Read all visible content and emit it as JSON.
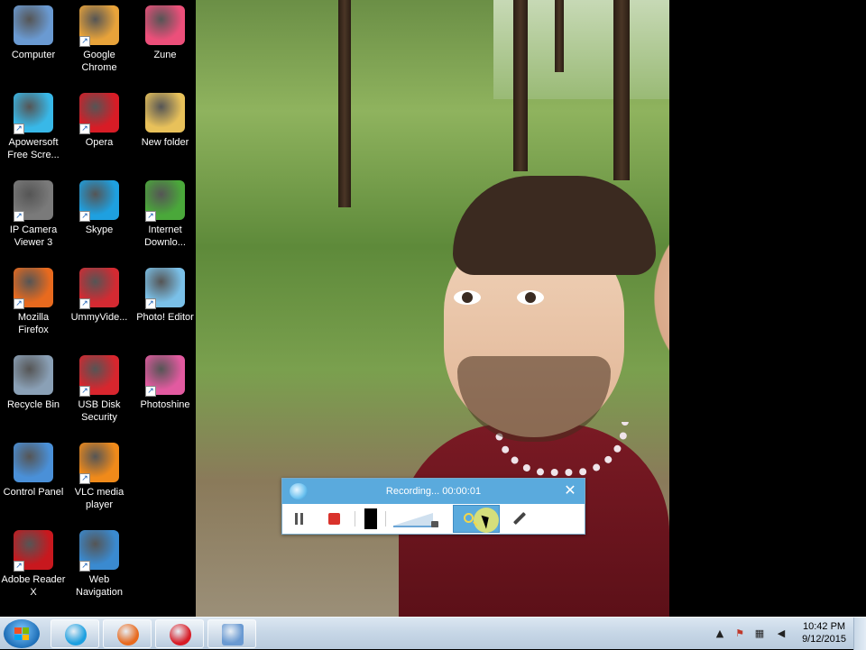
{
  "desktop": {
    "icons": [
      {
        "label": "Computer",
        "icon": "computer-icon",
        "color": "#6a9ad2"
      },
      {
        "label": "Google\nChrome",
        "icon": "chrome-icon",
        "color": "#e8a33a"
      },
      {
        "label": "Zune",
        "icon": "zune-icon",
        "color": "#ec4f7a"
      },
      {
        "label": "Apowersoft\nFree Scre...",
        "icon": "apowersoft-icon",
        "color": "#38b8e8"
      },
      {
        "label": "Opera",
        "icon": "opera-icon",
        "color": "#d81c26"
      },
      {
        "label": "New folder",
        "icon": "folder-icon",
        "color": "#e8c15a"
      },
      {
        "label": "IP Camera\nViewer 3",
        "icon": "ip-camera-icon",
        "color": "#7a7a7a"
      },
      {
        "label": "Skype",
        "icon": "skype-icon",
        "color": "#1ea0e0"
      },
      {
        "label": "Internet\nDownlo...",
        "icon": "idm-icon",
        "color": "#4aa83a"
      },
      {
        "label": "Mozilla\nFirefox",
        "icon": "firefox-icon",
        "color": "#e86a1e"
      },
      {
        "label": "UmmyVide...",
        "icon": "ummy-icon",
        "color": "#d42a32"
      },
      {
        "label": "Photo! Editor",
        "icon": "photo-editor-icon",
        "color": "#7ac0e8"
      },
      {
        "label": "Recycle Bin",
        "icon": "recycle-bin-icon",
        "color": "#8aa0b6"
      },
      {
        "label": "USB Disk\nSecurity",
        "icon": "usb-disk-security-icon",
        "color": "#d8262e"
      },
      {
        "label": "Photoshine",
        "icon": "photoshine-icon",
        "color": "#e25aa0"
      },
      {
        "label": "Control Panel",
        "icon": "control-panel-icon",
        "color": "#4a90d8"
      },
      {
        "label": "VLC media\nplayer",
        "icon": "vlc-icon",
        "color": "#f08a1a"
      },
      {
        "label": "",
        "icon": "empty",
        "color": "#000000"
      },
      {
        "label": "Adobe Reader\nX",
        "icon": "adobe-reader-icon",
        "color": "#c8181e"
      },
      {
        "label": "Web\nNavigation",
        "icon": "web-navigation-icon",
        "color": "#3a8ad0"
      }
    ]
  },
  "recorder": {
    "status": "Recording... 00:00:01",
    "close": "✕"
  },
  "taskbar": {
    "pinned": [
      {
        "name": "skype",
        "color": "#1ea0e0"
      },
      {
        "name": "firefox",
        "color": "#e86a1e"
      },
      {
        "name": "opera",
        "color": "#d81c26"
      },
      {
        "name": "photo-viewer",
        "color": "#6a9ad2"
      }
    ],
    "clock": {
      "time": "10:42 PM",
      "date": "9/12/2015"
    }
  }
}
